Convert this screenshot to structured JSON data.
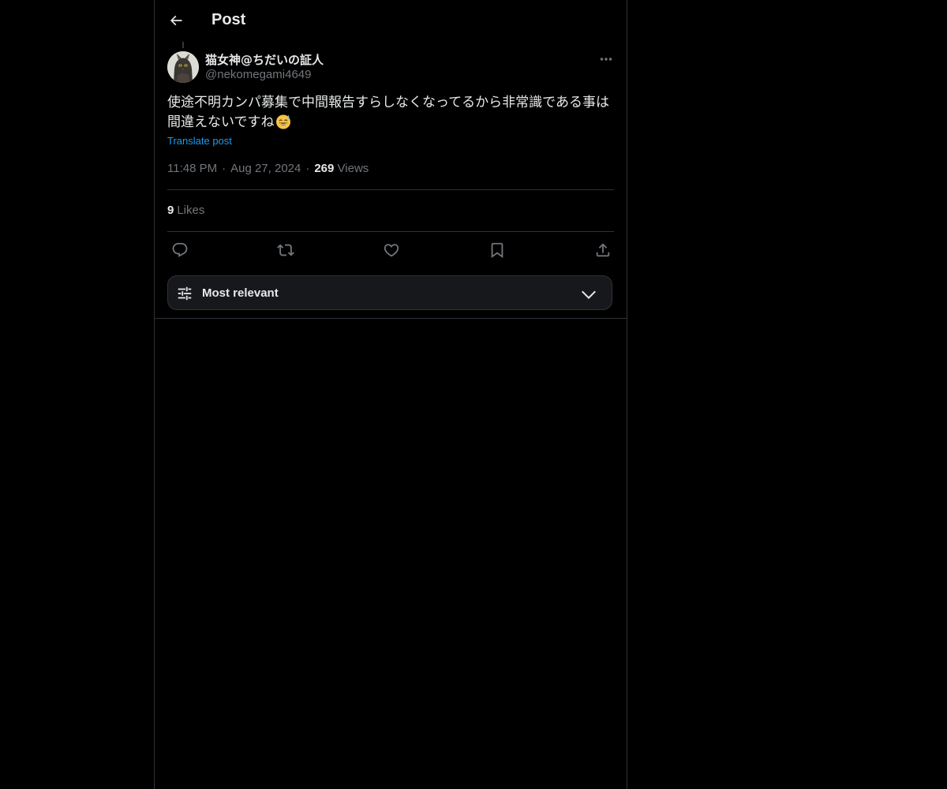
{
  "header": {
    "title": "Post",
    "back_icon": "arrow-left-icon"
  },
  "author": {
    "name": "猫女神@ちだいの証人",
    "handle": "@nekomegami4649",
    "avatar_icon": "cat-avatar"
  },
  "post": {
    "text": "使途不明カンパ募集で中間報告すらしなくなってるから非常識である事は間違えないですね",
    "emoji_icon": "grinning-sweat-emoji",
    "translate_label": "Translate post"
  },
  "meta": {
    "time": "11:48 PM",
    "separator": "·",
    "date": "Aug 27, 2024",
    "views_count": "269",
    "views_label": "Views"
  },
  "stats": {
    "likes_count": "9",
    "likes_label": "Likes"
  },
  "actions": {
    "icons": [
      "reply-icon",
      "repost-icon",
      "like-icon",
      "bookmark-icon",
      "share-icon"
    ]
  },
  "sort": {
    "label": "Most relevant",
    "icon": "sliders-icon"
  },
  "colors": {
    "background": "#000000",
    "text": "#e7e9ea",
    "muted": "#71767b",
    "link": "#1d9bf0",
    "border": "#2f3336"
  }
}
